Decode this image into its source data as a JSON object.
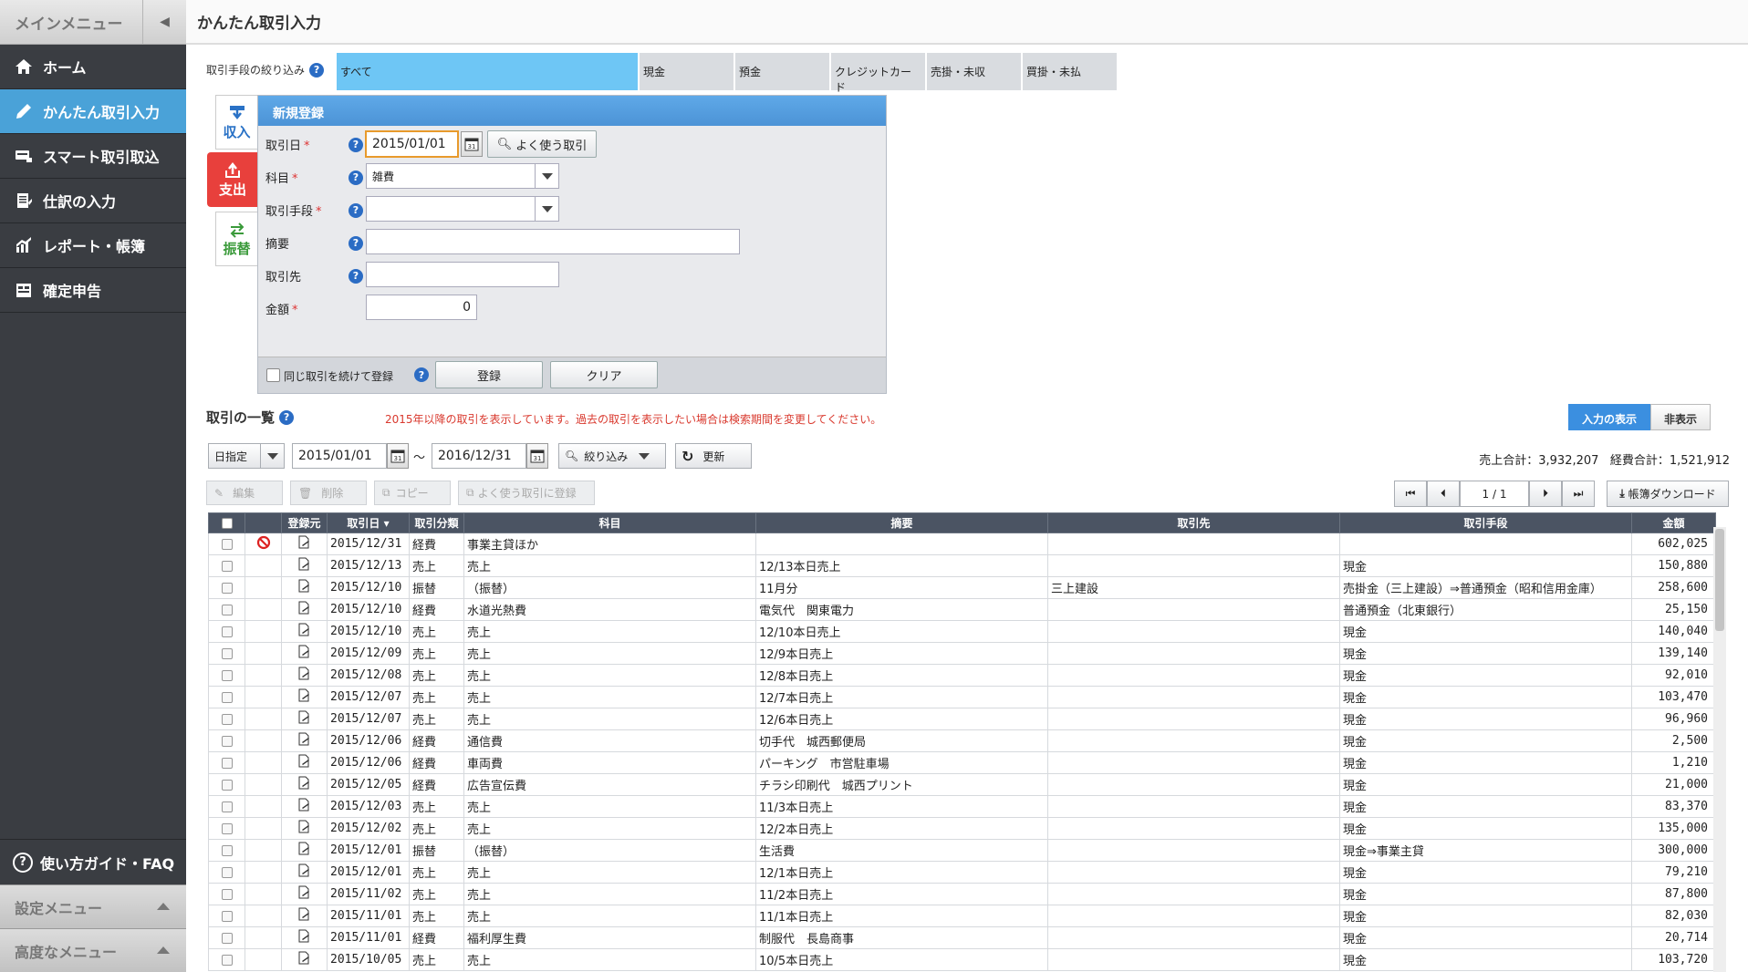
{
  "sidebar": {
    "header": "メインメニュー",
    "items": [
      {
        "label": "ホーム",
        "icon": "home-icon"
      },
      {
        "label": "かんたん取引入力",
        "icon": "pencil-icon"
      },
      {
        "label": "スマート取引取込",
        "icon": "card-import-icon"
      },
      {
        "label": "仕訳の入力",
        "icon": "journal-icon"
      },
      {
        "label": "レポート・帳簿",
        "icon": "report-icon"
      },
      {
        "label": "確定申告",
        "icon": "tax-return-icon"
      }
    ],
    "guide": "使い方ガイド・FAQ",
    "settings_menu": "設定メニュー",
    "advanced_menu": "高度なメニュー"
  },
  "page": {
    "title": "かんたん取引入力"
  },
  "filter": {
    "label": "取引手段の絞り込み",
    "tabs": [
      "すべて",
      "現金",
      "預金",
      "クレジットカード",
      "売掛・未収",
      "買掛・未払"
    ],
    "active": 0
  },
  "type_tabs": {
    "income": "収入",
    "expense": "支出",
    "transfer": "振替"
  },
  "form": {
    "title": "新規登録",
    "date_label": "取引日",
    "date_value": "2015/01/01",
    "frequent_button": "よく使う取引",
    "account_label": "科目",
    "account_value": "雑費",
    "method_label": "取引手段",
    "method_value": "",
    "memo_label": "摘要",
    "memo_value": "",
    "partner_label": "取引先",
    "partner_value": "",
    "amount_label": "金額",
    "amount_value": "0",
    "repeat_label": "同じ取引を続けて登録",
    "register_button": "登録",
    "clear_button": "クリア"
  },
  "list": {
    "title": "取引の一覧",
    "notice": "2015年以降の取引を表示しています。過去の取引を表示したい場合は検索期間を変更してください。",
    "show_input": "入力の表示",
    "hide_input": "非表示",
    "period_mode": "日指定",
    "date_from": "2015/01/01",
    "date_to": "2016/12/31",
    "tilde": "～",
    "narrow_button": "絞り込み",
    "refresh_button": "更新",
    "sales_total": "売上合計：3,932,207",
    "expense_total": "経費合計：1,521,912",
    "edit": "編集",
    "delete": "削除",
    "copy": "コピー",
    "save_frequent": "よく使う取引に登録",
    "page_current": "1",
    "page_sep": "/",
    "page_total": "1",
    "download": "帳簿ダウンロード",
    "columns": [
      "登録元",
      "取引日 ▾",
      "取引分類",
      "科目",
      "摘要",
      "取引先",
      "取引手段",
      "金額"
    ],
    "rows": [
      {
        "blocked": true,
        "date": "2015/12/31",
        "type": "経費",
        "account": "事業主貸ほか",
        "memo": "",
        "partner": "",
        "method": "",
        "amount": "602,025"
      },
      {
        "blocked": false,
        "date": "2015/12/13",
        "type": "売上",
        "account": "売上",
        "memo": "12/13本日売上",
        "partner": "",
        "method": "現金",
        "amount": "150,880"
      },
      {
        "blocked": false,
        "date": "2015/12/10",
        "type": "振替",
        "account": "（振替）",
        "memo": "11月分",
        "partner": "三上建設",
        "method": "売掛金（三上建設）⇒普通預金（昭和信用金庫）",
        "amount": "258,600"
      },
      {
        "blocked": false,
        "date": "2015/12/10",
        "type": "経費",
        "account": "水道光熱費",
        "memo": "電気代　関東電力",
        "partner": "",
        "method": "普通預金（北東銀行）",
        "amount": "25,150"
      },
      {
        "blocked": false,
        "date": "2015/12/10",
        "type": "売上",
        "account": "売上",
        "memo": "12/10本日売上",
        "partner": "",
        "method": "現金",
        "amount": "140,040"
      },
      {
        "blocked": false,
        "date": "2015/12/09",
        "type": "売上",
        "account": "売上",
        "memo": "12/9本日売上",
        "partner": "",
        "method": "現金",
        "amount": "139,140"
      },
      {
        "blocked": false,
        "date": "2015/12/08",
        "type": "売上",
        "account": "売上",
        "memo": "12/8本日売上",
        "partner": "",
        "method": "現金",
        "amount": "92,010"
      },
      {
        "blocked": false,
        "date": "2015/12/07",
        "type": "売上",
        "account": "売上",
        "memo": "12/7本日売上",
        "partner": "",
        "method": "現金",
        "amount": "103,470"
      },
      {
        "blocked": false,
        "date": "2015/12/07",
        "type": "売上",
        "account": "売上",
        "memo": "12/6本日売上",
        "partner": "",
        "method": "現金",
        "amount": "96,960"
      },
      {
        "blocked": false,
        "date": "2015/12/06",
        "type": "経費",
        "account": "通信費",
        "memo": "切手代　城西郵便局",
        "partner": "",
        "method": "現金",
        "amount": "2,500"
      },
      {
        "blocked": false,
        "date": "2015/12/06",
        "type": "経費",
        "account": "車両費",
        "memo": "パーキング　市営駐車場",
        "partner": "",
        "method": "現金",
        "amount": "1,210"
      },
      {
        "blocked": false,
        "date": "2015/12/05",
        "type": "経費",
        "account": "広告宣伝費",
        "memo": "チラシ印刷代　城西プリント",
        "partner": "",
        "method": "現金",
        "amount": "21,000"
      },
      {
        "blocked": false,
        "date": "2015/12/03",
        "type": "売上",
        "account": "売上",
        "memo": "11/3本日売上",
        "partner": "",
        "method": "現金",
        "amount": "83,370"
      },
      {
        "blocked": false,
        "date": "2015/12/02",
        "type": "売上",
        "account": "売上",
        "memo": "12/2本日売上",
        "partner": "",
        "method": "現金",
        "amount": "135,000"
      },
      {
        "blocked": false,
        "date": "2015/12/01",
        "type": "振替",
        "account": "（振替）",
        "memo": "生活費",
        "partner": "",
        "method": "現金⇒事業主貸",
        "amount": "300,000"
      },
      {
        "blocked": false,
        "date": "2015/12/01",
        "type": "売上",
        "account": "売上",
        "memo": "12/1本日売上",
        "partner": "",
        "method": "現金",
        "amount": "79,210"
      },
      {
        "blocked": false,
        "date": "2015/11/02",
        "type": "売上",
        "account": "売上",
        "memo": "11/2本日売上",
        "partner": "",
        "method": "現金",
        "amount": "87,800"
      },
      {
        "blocked": false,
        "date": "2015/11/01",
        "type": "売上",
        "account": "売上",
        "memo": "11/1本日売上",
        "partner": "",
        "method": "現金",
        "amount": "82,030"
      },
      {
        "blocked": false,
        "date": "2015/11/01",
        "type": "経費",
        "account": "福利厚生費",
        "memo": "制服代　長島商事",
        "partner": "",
        "method": "現金",
        "amount": "20,714"
      },
      {
        "blocked": false,
        "date": "2015/10/05",
        "type": "売上",
        "account": "売上",
        "memo": "10/5本日売上",
        "partner": "",
        "method": "現金",
        "amount": "103,720"
      }
    ]
  }
}
